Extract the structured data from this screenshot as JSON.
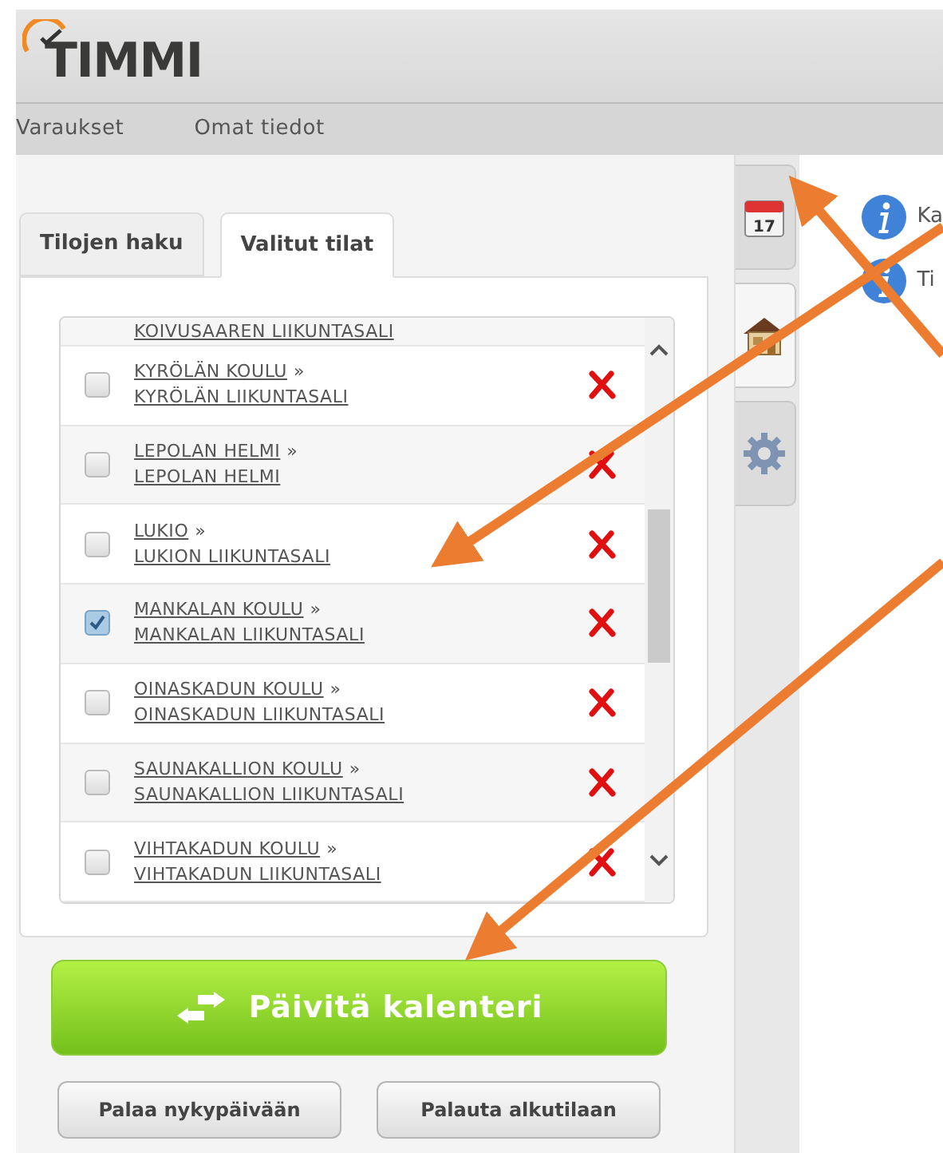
{
  "logo": {
    "text": "TIMMI"
  },
  "nav": [
    {
      "label": "Varaukset"
    },
    {
      "label": "Omat tiedot"
    }
  ],
  "tabs": [
    {
      "label": "Tilojen haku",
      "selected": false
    },
    {
      "label": "Valitut tilat",
      "selected": true
    }
  ],
  "rows": [
    {
      "kind": "partial",
      "hall": "KOIVUSAAREN LIIKUNTASALI"
    },
    {
      "school": "KYRÖLÄN KOULU",
      "hall": "KYRÖLÄN LIIKUNTASALI",
      "checked": false
    },
    {
      "school": "LEPOLAN HELMI",
      "hall": "LEPOLAN HELMI",
      "checked": false
    },
    {
      "school": "LUKIO",
      "hall": "LUKION LIIKUNTASALI",
      "checked": false
    },
    {
      "school": "MANKALAN KOULU",
      "hall": "MANKALAN LIIKUNTASALI",
      "checked": true
    },
    {
      "school": "OINASKADUN KOULU",
      "hall": "OINASKADUN LIIKUNTASALI",
      "checked": false
    },
    {
      "school": "SAUNAKALLION KOULU",
      "hall": "SAUNAKALLION LIIKUNTASALI",
      "checked": false
    },
    {
      "school": "VIHTAKADUN KOULU",
      "hall": "VIHTAKADUN LIIKUNTASALI",
      "checked": false
    }
  ],
  "separator": "»",
  "update_button": "Päivitä kalenteri",
  "buttons": [
    "Palaa nykypäivään",
    "Palauta alkutilaan"
  ],
  "side_tabs": [
    {
      "kind": "calendar",
      "selected": false,
      "day": "17"
    },
    {
      "kind": "house",
      "selected": true
    },
    {
      "kind": "gear",
      "selected": false
    }
  ],
  "info": [
    {
      "text": "Ka"
    },
    {
      "text": "Ti"
    }
  ]
}
